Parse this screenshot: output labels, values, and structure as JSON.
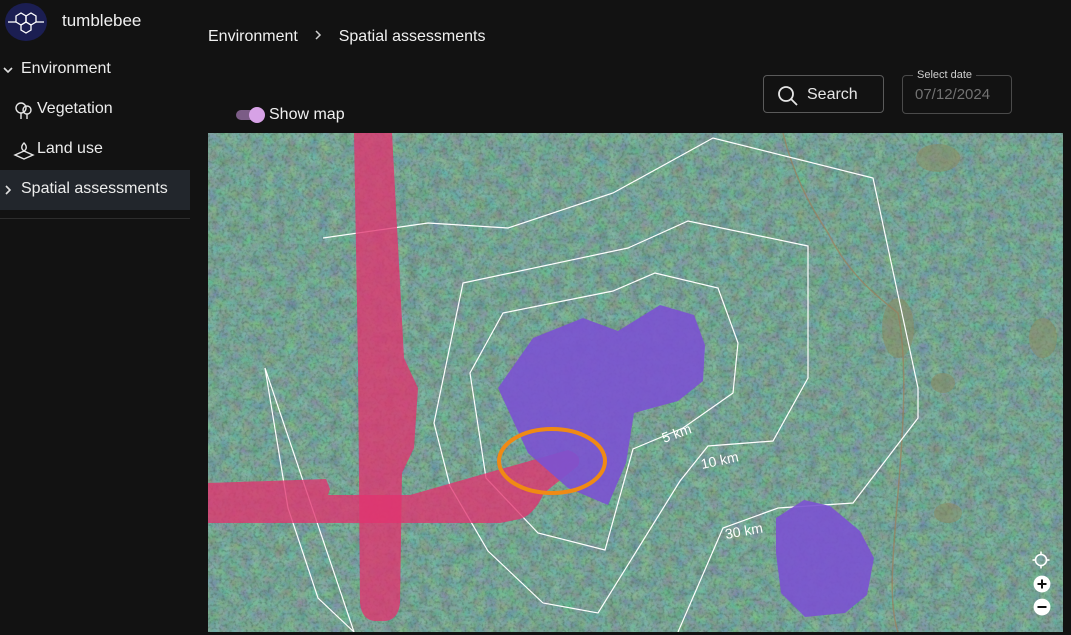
{
  "app": {
    "name": "tumblebee"
  },
  "sidebar": {
    "items": [
      {
        "label": "Environment",
        "expanded": true
      },
      {
        "label": "Vegetation",
        "icon": "vegetation-icon"
      },
      {
        "label": "Land use",
        "icon": "land-use-icon"
      },
      {
        "label": "Spatial assessments",
        "active": true
      }
    ]
  },
  "breadcrumb": {
    "items": [
      "Environment",
      "Spatial assessments"
    ]
  },
  "search": {
    "label": "Search"
  },
  "date_picker": {
    "label": "Select date",
    "value": "07/12/2024"
  },
  "map_toggle": {
    "label": "Show map",
    "on": true
  },
  "map": {
    "ring_labels": [
      "5 km",
      "10 km",
      "30 km"
    ],
    "colors": {
      "road": "#e2336f",
      "area": "#7b52d1",
      "highlight": "#f08a14",
      "ring": "#ffffff",
      "toggle_accent": "#d7a2e6"
    }
  }
}
